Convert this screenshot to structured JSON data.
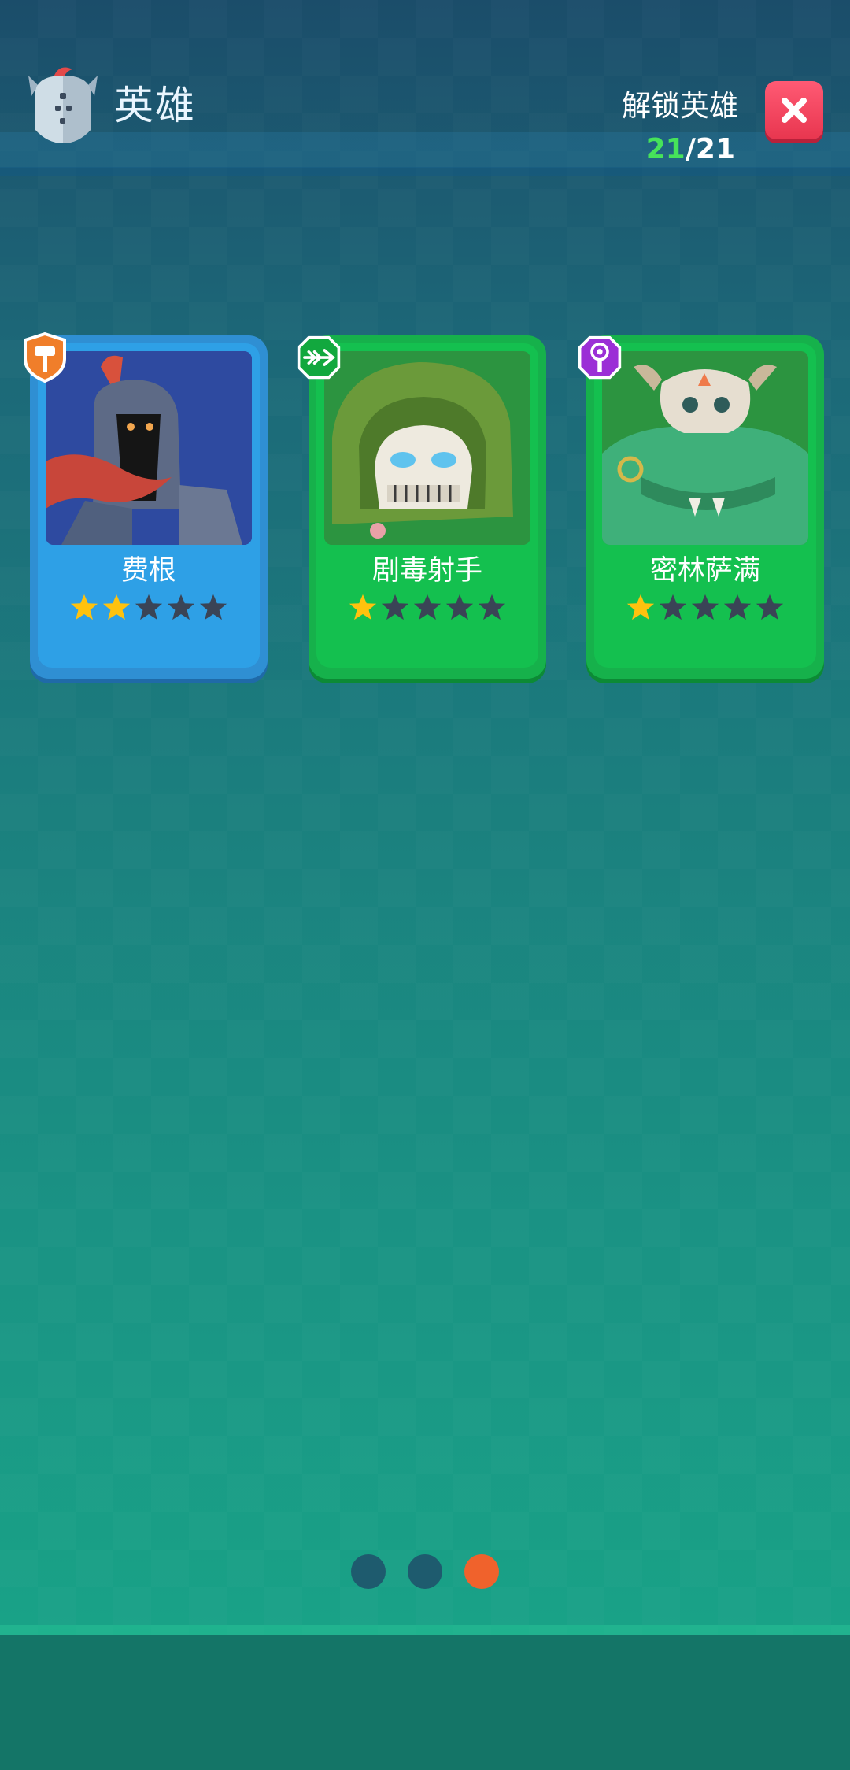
{
  "header": {
    "title": "英雄",
    "unlock_label": "解锁英雄",
    "unlocked_count": "21",
    "separator": "/",
    "total_count": "21",
    "helmet_icon": "knight-helmet-icon",
    "close_icon": "close-icon"
  },
  "heroes": [
    {
      "name": "费根",
      "stars": 2,
      "max_stars": 5,
      "class_icon": "hammer-shield-icon",
      "card_color": "#2ea0e6"
    },
    {
      "name": "剧毒射手",
      "stars": 1,
      "max_stars": 5,
      "class_icon": "arrow-icon",
      "card_color": "#14c04f"
    },
    {
      "name": "密林萨满",
      "stars": 1,
      "max_stars": 5,
      "class_icon": "magic-staff-icon",
      "card_color": "#14c04f"
    }
  ],
  "pagination": {
    "pages": 3,
    "current": 3
  },
  "colors": {
    "active_dot": "#f0622c",
    "inactive_dot": "#1e5b6e",
    "star_filled": "#ffc20e",
    "star_empty": "#3a4456",
    "count_green": "#46e35a"
  }
}
